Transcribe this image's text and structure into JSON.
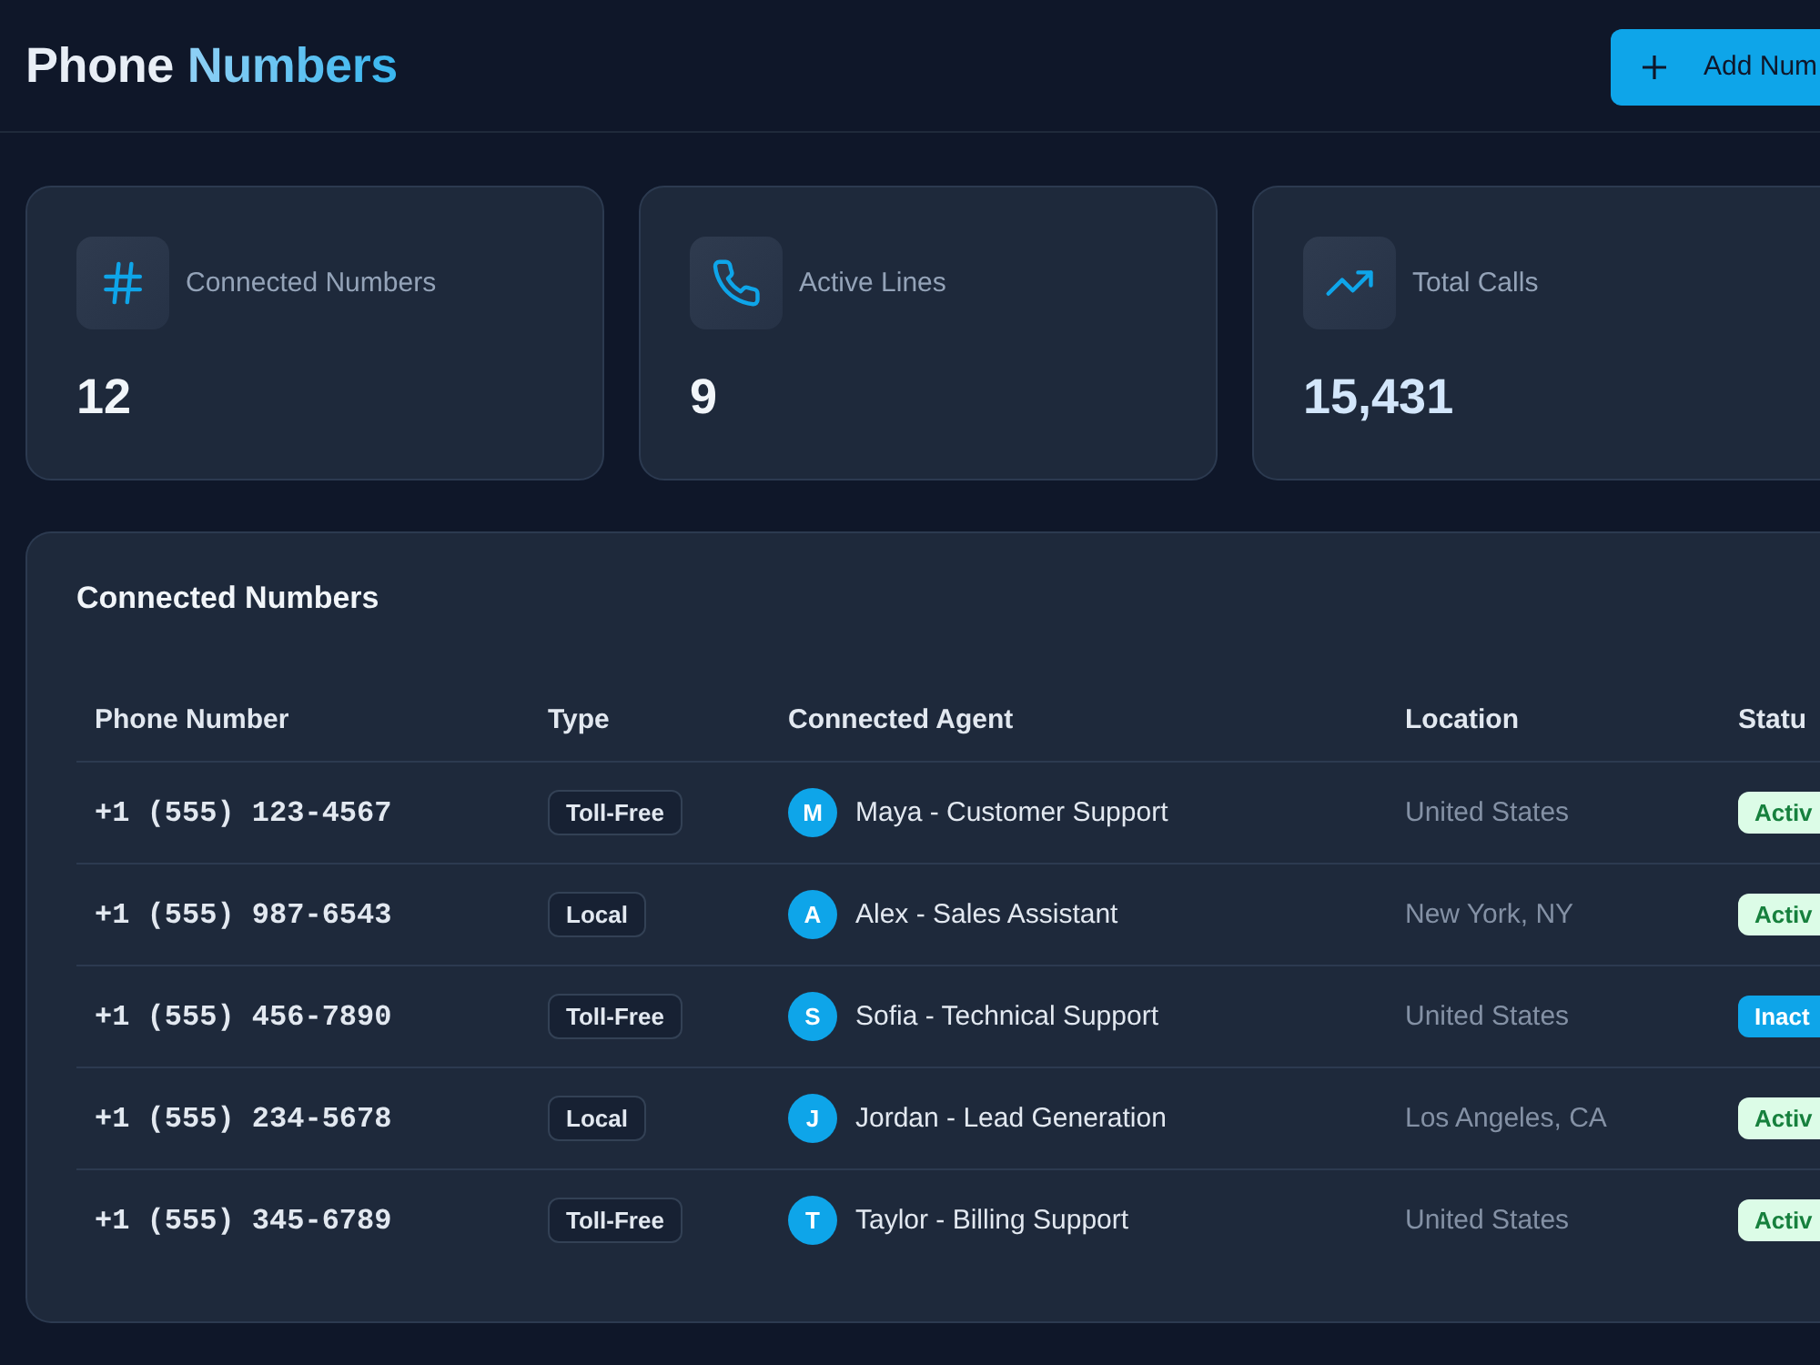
{
  "header": {
    "title": "Phone",
    "title_highlight": "Numbers",
    "add_button": "Add Num"
  },
  "stats": [
    {
      "label": "Connected Numbers",
      "value": "12",
      "highlighted": false
    },
    {
      "label": "Active Lines",
      "value": "9",
      "highlighted": false
    },
    {
      "label": "Total Calls",
      "value": "15,431",
      "highlighted": true
    }
  ],
  "table": {
    "title": "Connected Numbers",
    "columns": [
      "Phone Number",
      "Type",
      "Connected Agent",
      "Location",
      "Statu"
    ],
    "rows": [
      {
        "phone": "+1 (555) 123-4567",
        "type": "Toll-Free",
        "agent_initial": "M",
        "agent": "Maya - Customer Support",
        "location": "United States",
        "status": {
          "kind": "active",
          "text": "Activ"
        }
      },
      {
        "phone": "+1 (555) 987-6543",
        "type": "Local",
        "agent_initial": "A",
        "agent": "Alex - Sales Assistant",
        "location": "New York, NY",
        "status": {
          "kind": "active",
          "text": "Activ"
        }
      },
      {
        "phone": "+1 (555) 456-7890",
        "type": "Toll-Free",
        "agent_initial": "S",
        "agent": "Sofia - Technical Support",
        "location": "United States",
        "status": {
          "kind": "inactive",
          "text": "Inact"
        }
      },
      {
        "phone": "+1 (555) 234-5678",
        "type": "Local",
        "agent_initial": "J",
        "agent": "Jordan - Lead Generation",
        "location": "Los Angeles, CA",
        "status": {
          "kind": "active",
          "text": "Activ"
        }
      },
      {
        "phone": "+1 (555) 345-6789",
        "type": "Toll-Free",
        "agent_initial": "T",
        "agent": "Taylor - Billing Support",
        "location": "United States",
        "status": {
          "kind": "active",
          "text": "Activ"
        }
      }
    ]
  }
}
